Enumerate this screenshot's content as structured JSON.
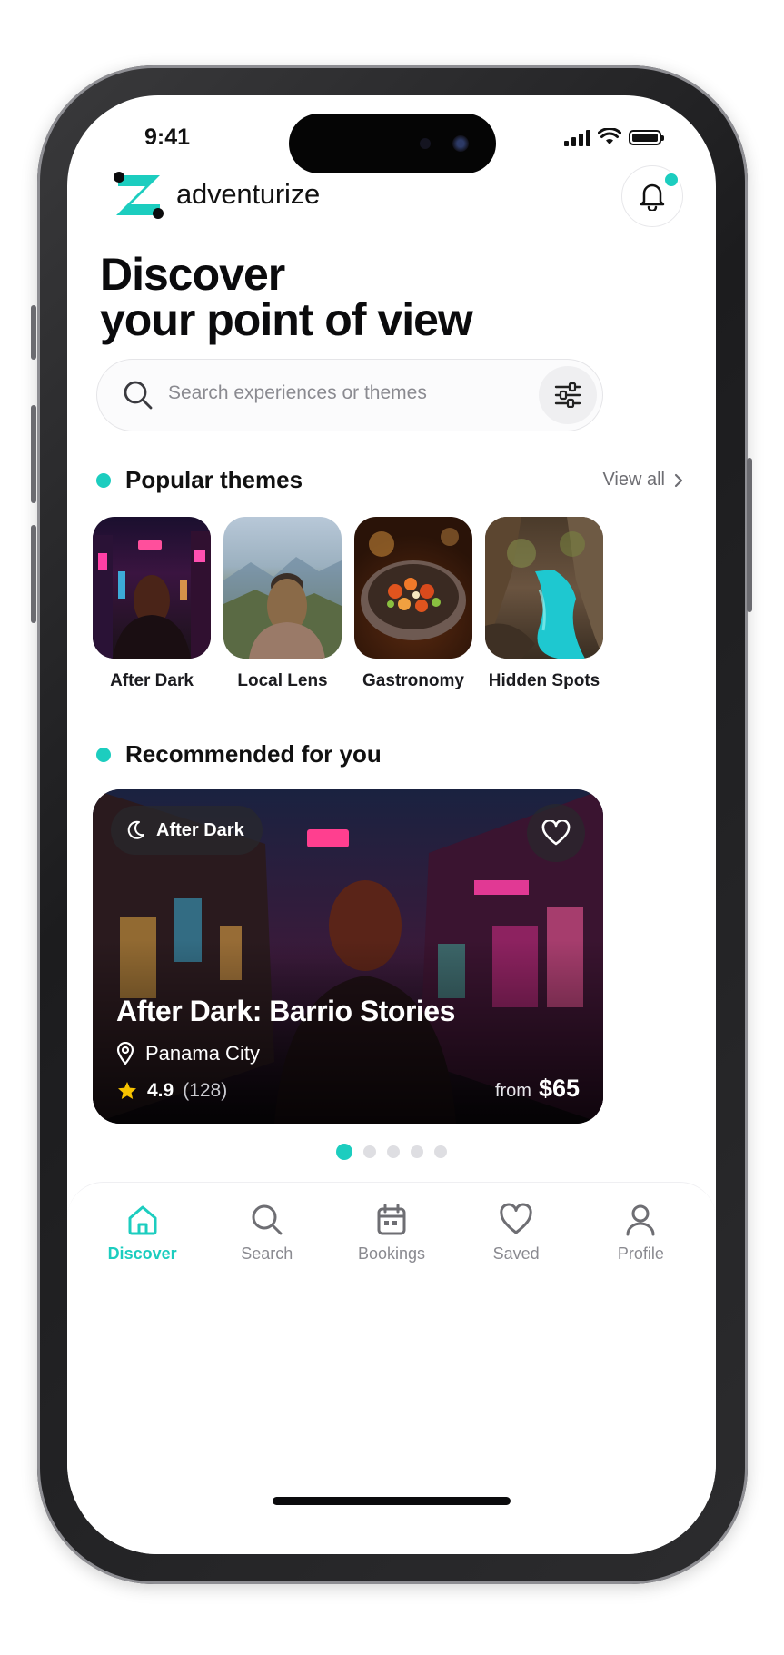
{
  "status_bar": {
    "time": "9:41"
  },
  "app": {
    "name": "adventurize"
  },
  "header": {
    "line1": "Discover",
    "line2": "your point of view"
  },
  "search": {
    "placeholder": "Search experiences or themes"
  },
  "popular": {
    "title": "Popular themes",
    "view_all": "View all",
    "themes": [
      {
        "label": "After Dark"
      },
      {
        "label": "Local Lens"
      },
      {
        "label": "Gastronomy"
      },
      {
        "label": "Hidden Spots"
      }
    ]
  },
  "recommended": {
    "title": "Recommended for you",
    "card": {
      "tag": "After Dark",
      "title": "After Dark: Barrio Stories",
      "location": "Panama City",
      "rating": "4.9",
      "reviews": "(128)",
      "price_prefix": "from",
      "price": "$65"
    },
    "carousel": {
      "count": 5,
      "active": 1
    }
  },
  "tabbar": {
    "items": [
      {
        "label": "Discover",
        "icon": "home-icon",
        "active": true
      },
      {
        "label": "Search",
        "icon": "search-icon",
        "active": false
      },
      {
        "label": "Bookings",
        "icon": "calendar-icon",
        "active": false
      },
      {
        "label": "Saved",
        "icon": "heart-icon",
        "active": false
      },
      {
        "label": "Profile",
        "icon": "user-icon",
        "active": false
      }
    ]
  },
  "colors": {
    "accent": "#1ccdbf",
    "text": "#111111",
    "muted": "#8a8a90"
  }
}
